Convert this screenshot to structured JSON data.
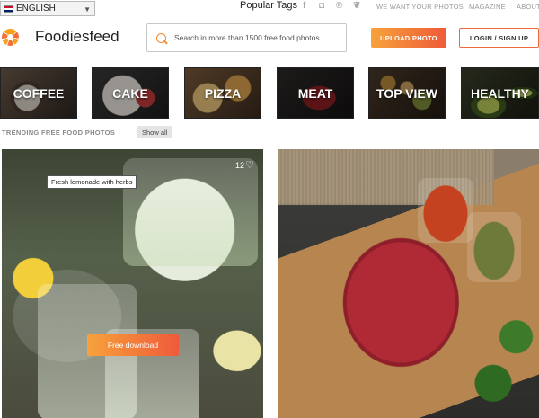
{
  "language": {
    "selected": "ENGLISH"
  },
  "nav": {
    "popular_tags": "Popular Tags",
    "social": [
      {
        "name": "facebook",
        "glyph": "f"
      },
      {
        "name": "instagram",
        "glyph": "◘"
      },
      {
        "name": "pinterest",
        "glyph": "℗"
      },
      {
        "name": "twitter",
        "glyph": "❦"
      }
    ],
    "links": [
      "WE WANT YOUR PHOTOS",
      "MAGAZINE",
      "ABOUT"
    ]
  },
  "header": {
    "logo_text": "Foodiesfeed",
    "search_placeholder": "Search in more than 1500 free food photos",
    "upload_label": "UPLOAD PHOTO",
    "login_label": "LOGIN / SIGN UP"
  },
  "categories": [
    "COFFEE",
    "CAKE",
    "PIZZA",
    "MEAT",
    "TOP VIEW",
    "HEALTHY"
  ],
  "trending": {
    "title": "TRENDING FREE FOOD PHOTOS",
    "show_all": "Show all"
  },
  "photos": [
    {
      "title": "Fresh lemonade with herbs",
      "likes": "12",
      "download_label": "Free download"
    }
  ],
  "colors": {
    "accent_start": "#f7a23b",
    "accent_end": "#ef5a3a"
  }
}
